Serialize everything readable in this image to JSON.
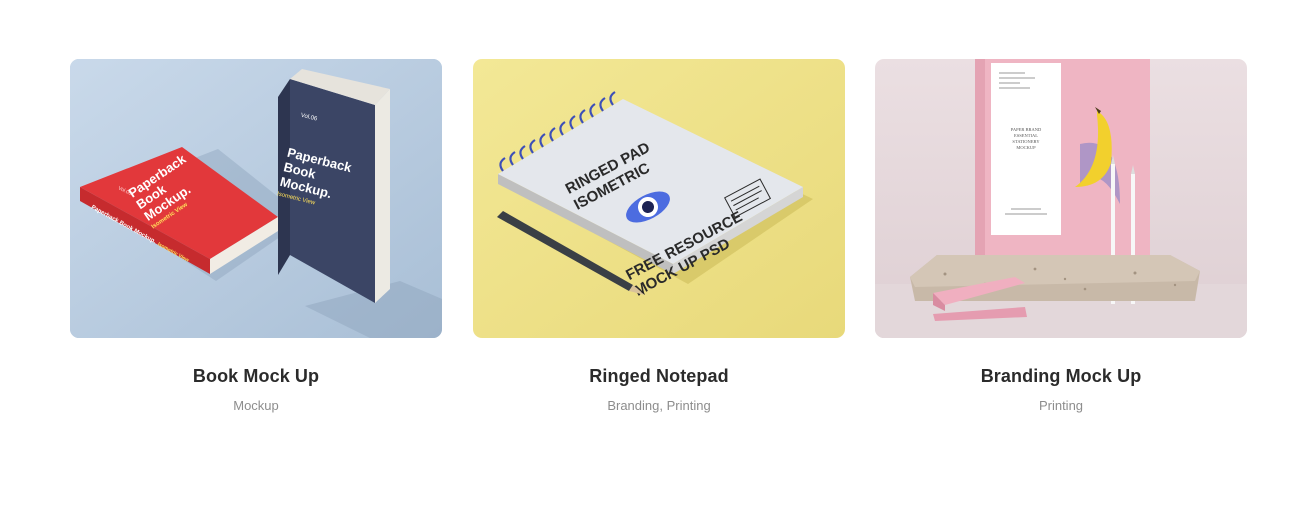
{
  "portfolio": {
    "items": [
      {
        "title": "Book Mock Up",
        "categories_text": "Mockup",
        "art": {
          "background": "#b9cde0",
          "red_book_lines": [
            "Paperback",
            "Book",
            "Mockup."
          ],
          "red_book_subtitle": "Isometric View",
          "red_book_spine": "Paperback Book Mockup.",
          "red_book_spine_tag": "Isometric View",
          "red_book_vol": "Vol.06",
          "blue_book_vol": "Vol.06",
          "blue_book_lines": [
            "Paperback",
            "Book",
            "Mockup."
          ],
          "blue_book_subtitle": "Isometric View",
          "red_color": "#e2383b",
          "navy_color": "#3b4565"
        }
      },
      {
        "title": "Ringed Notepad",
        "categories_text": "Branding, Printing",
        "art": {
          "background": "#efe38b",
          "lines_top": [
            "RINGED PAD",
            "ISOMETRIC"
          ],
          "lines_bottom": [
            "FREE RESOURCE",
            "MOCK UP PSD"
          ],
          "ring_color": "#3d4fb8",
          "eye_color": "#4c6ce0"
        }
      },
      {
        "title": "Branding Mock Up",
        "categories_text": "Printing",
        "art": {
          "background": "#e8dadd",
          "card_lines": [
            "PAPER BRAND",
            "ESSENTIAL",
            "STATIONERY",
            "MOCKUP"
          ],
          "pink_color": "#efb5c3",
          "banana_color": "#f2d02d"
        }
      }
    ]
  }
}
